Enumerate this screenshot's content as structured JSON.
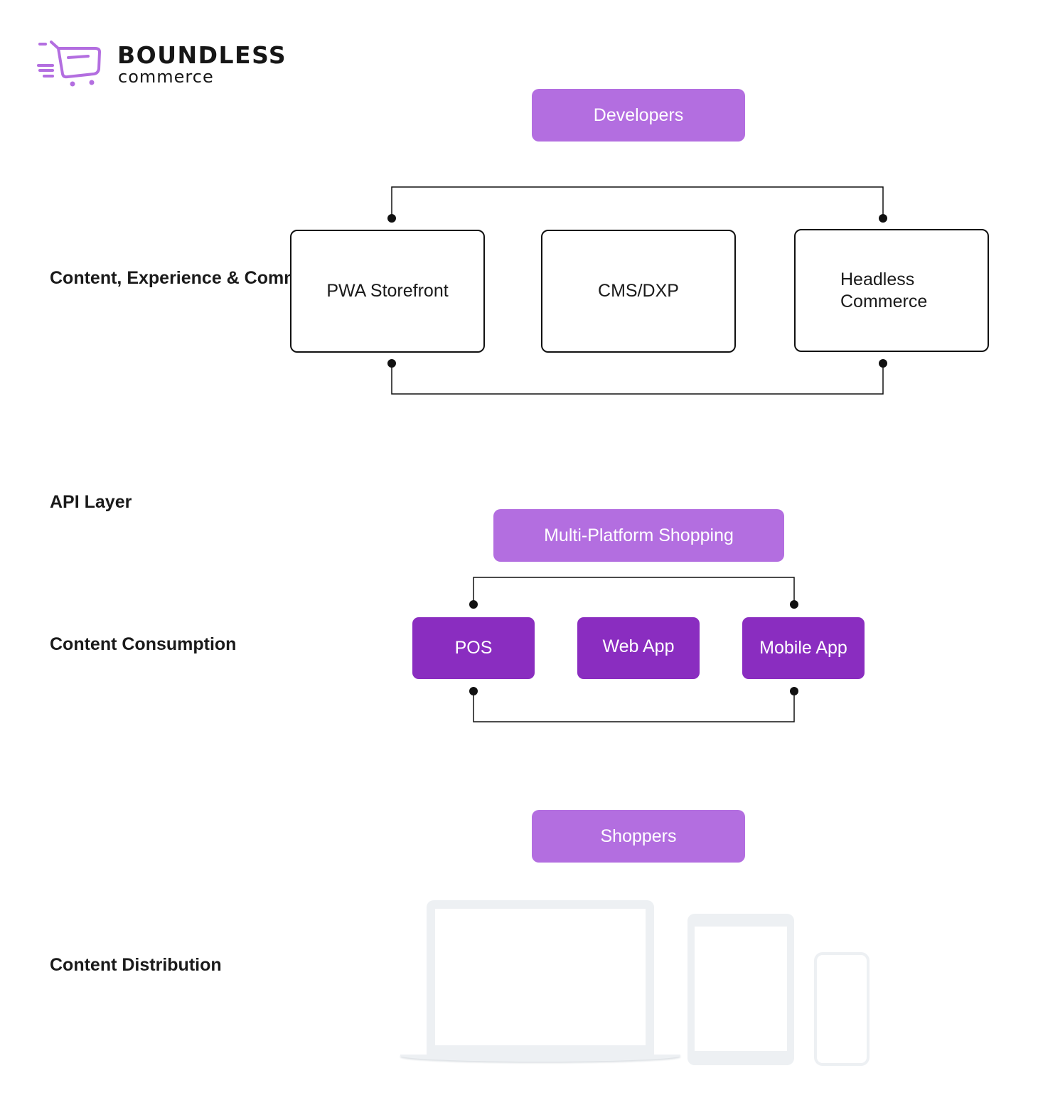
{
  "logo": {
    "wordmark": "BOUNDLESS",
    "tagline": "commerce",
    "icon": "shopping-cart-icon",
    "color": "#b36ee0"
  },
  "row_labels": {
    "platforms": "Content, Experience & Commerce Platforms",
    "api_layer": "API Layer",
    "consumption": "Content Consumption",
    "distribution": "Content Distribution"
  },
  "nodes": {
    "developers": "Developers",
    "platforms": [
      "PWA Storefront",
      "CMS/DXP",
      "Headless Commerce"
    ],
    "multi_platform": "Multi-Platform Shopping",
    "channels": [
      "POS",
      "Web App",
      "Mobile App"
    ],
    "shoppers": "Shoppers"
  },
  "devices": [
    "laptop-icon",
    "tablet-icon",
    "phone-icon"
  ],
  "colors": {
    "pill": "#b36ee0",
    "channel": "#8a2dc0",
    "outline": "#111111",
    "device": "#edf0f3"
  }
}
